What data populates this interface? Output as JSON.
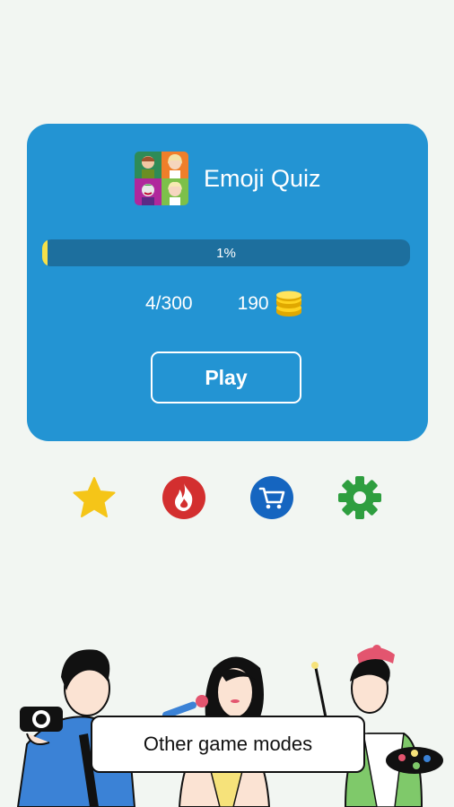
{
  "app": {
    "title": "Emoji Quiz",
    "icon": "app-portrait-grid-icon"
  },
  "progress": {
    "label": "1%",
    "fraction": 0.01
  },
  "stats": {
    "levels": "4/300",
    "coins": "190"
  },
  "play": {
    "label": "Play"
  },
  "actions": [
    {
      "name": "star-icon",
      "color": "#f5c518"
    },
    {
      "name": "fire-icon",
      "color": "#d32f2f"
    },
    {
      "name": "cart-icon",
      "color": "#1565c0"
    },
    {
      "name": "gear-icon",
      "color": "#2e9e3f"
    }
  ],
  "modes": {
    "label": "Other game modes"
  },
  "colors": {
    "card": "#2394d3",
    "track": "#1d6f9e",
    "fill": "#f6e04a",
    "background": "#f2f6f2"
  }
}
